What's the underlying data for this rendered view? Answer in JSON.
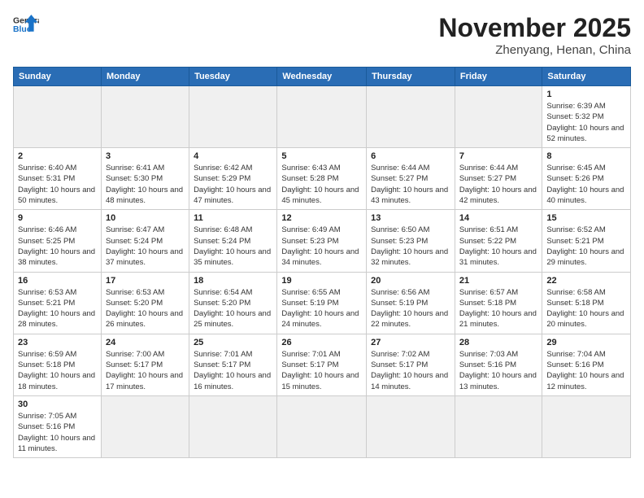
{
  "header": {
    "logo_general": "General",
    "logo_blue": "Blue",
    "month_title": "November 2025",
    "location": "Zhenyang, Henan, China"
  },
  "weekdays": [
    "Sunday",
    "Monday",
    "Tuesday",
    "Wednesday",
    "Thursday",
    "Friday",
    "Saturday"
  ],
  "days": {
    "1": {
      "sunrise": "6:39 AM",
      "sunset": "5:32 PM",
      "daylight": "10 hours and 52 minutes."
    },
    "2": {
      "sunrise": "6:40 AM",
      "sunset": "5:31 PM",
      "daylight": "10 hours and 50 minutes."
    },
    "3": {
      "sunrise": "6:41 AM",
      "sunset": "5:30 PM",
      "daylight": "10 hours and 48 minutes."
    },
    "4": {
      "sunrise": "6:42 AM",
      "sunset": "5:29 PM",
      "daylight": "10 hours and 47 minutes."
    },
    "5": {
      "sunrise": "6:43 AM",
      "sunset": "5:28 PM",
      "daylight": "10 hours and 45 minutes."
    },
    "6": {
      "sunrise": "6:44 AM",
      "sunset": "5:27 PM",
      "daylight": "10 hours and 43 minutes."
    },
    "7": {
      "sunrise": "6:44 AM",
      "sunset": "5:27 PM",
      "daylight": "10 hours and 42 minutes."
    },
    "8": {
      "sunrise": "6:45 AM",
      "sunset": "5:26 PM",
      "daylight": "10 hours and 40 minutes."
    },
    "9": {
      "sunrise": "6:46 AM",
      "sunset": "5:25 PM",
      "daylight": "10 hours and 38 minutes."
    },
    "10": {
      "sunrise": "6:47 AM",
      "sunset": "5:24 PM",
      "daylight": "10 hours and 37 minutes."
    },
    "11": {
      "sunrise": "6:48 AM",
      "sunset": "5:24 PM",
      "daylight": "10 hours and 35 minutes."
    },
    "12": {
      "sunrise": "6:49 AM",
      "sunset": "5:23 PM",
      "daylight": "10 hours and 34 minutes."
    },
    "13": {
      "sunrise": "6:50 AM",
      "sunset": "5:23 PM",
      "daylight": "10 hours and 32 minutes."
    },
    "14": {
      "sunrise": "6:51 AM",
      "sunset": "5:22 PM",
      "daylight": "10 hours and 31 minutes."
    },
    "15": {
      "sunrise": "6:52 AM",
      "sunset": "5:21 PM",
      "daylight": "10 hours and 29 minutes."
    },
    "16": {
      "sunrise": "6:53 AM",
      "sunset": "5:21 PM",
      "daylight": "10 hours and 28 minutes."
    },
    "17": {
      "sunrise": "6:53 AM",
      "sunset": "5:20 PM",
      "daylight": "10 hours and 26 minutes."
    },
    "18": {
      "sunrise": "6:54 AM",
      "sunset": "5:20 PM",
      "daylight": "10 hours and 25 minutes."
    },
    "19": {
      "sunrise": "6:55 AM",
      "sunset": "5:19 PM",
      "daylight": "10 hours and 24 minutes."
    },
    "20": {
      "sunrise": "6:56 AM",
      "sunset": "5:19 PM",
      "daylight": "10 hours and 22 minutes."
    },
    "21": {
      "sunrise": "6:57 AM",
      "sunset": "5:18 PM",
      "daylight": "10 hours and 21 minutes."
    },
    "22": {
      "sunrise": "6:58 AM",
      "sunset": "5:18 PM",
      "daylight": "10 hours and 20 minutes."
    },
    "23": {
      "sunrise": "6:59 AM",
      "sunset": "5:18 PM",
      "daylight": "10 hours and 18 minutes."
    },
    "24": {
      "sunrise": "7:00 AM",
      "sunset": "5:17 PM",
      "daylight": "10 hours and 17 minutes."
    },
    "25": {
      "sunrise": "7:01 AM",
      "sunset": "5:17 PM",
      "daylight": "10 hours and 16 minutes."
    },
    "26": {
      "sunrise": "7:01 AM",
      "sunset": "5:17 PM",
      "daylight": "10 hours and 15 minutes."
    },
    "27": {
      "sunrise": "7:02 AM",
      "sunset": "5:17 PM",
      "daylight": "10 hours and 14 minutes."
    },
    "28": {
      "sunrise": "7:03 AM",
      "sunset": "5:16 PM",
      "daylight": "10 hours and 13 minutes."
    },
    "29": {
      "sunrise": "7:04 AM",
      "sunset": "5:16 PM",
      "daylight": "10 hours and 12 minutes."
    },
    "30": {
      "sunrise": "7:05 AM",
      "sunset": "5:16 PM",
      "daylight": "10 hours and 11 minutes."
    }
  },
  "labels": {
    "sunrise": "Sunrise:",
    "sunset": "Sunset:",
    "daylight": "Daylight:"
  }
}
